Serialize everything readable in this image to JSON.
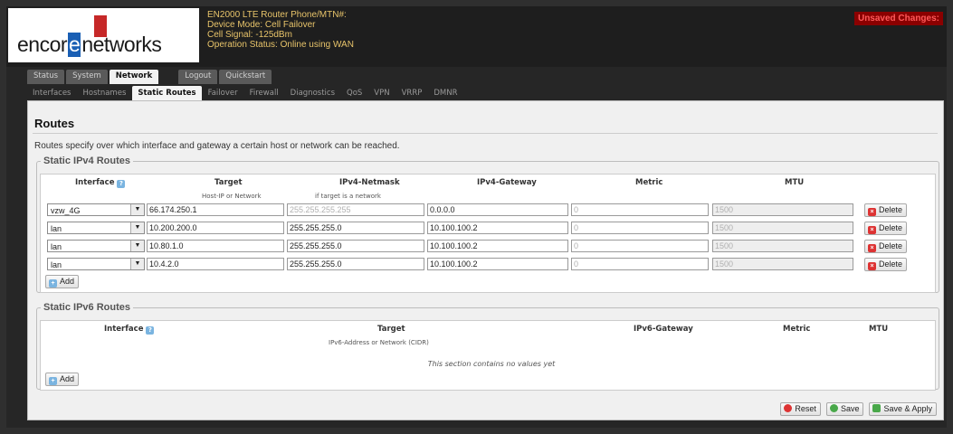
{
  "header": {
    "logo": {
      "left": "encor",
      "mid": "e",
      "right": "networks"
    },
    "status_lines": [
      "EN2000 LTE Router Phone/MTN#:",
      "Device Mode: Cell Failover",
      "Cell Signal: -125dBm",
      "Operation Status: Online using WAN"
    ],
    "unsaved": "Unsaved Changes:"
  },
  "nav": {
    "tabs": [
      "Status",
      "System",
      "Network",
      "Logout",
      "Quickstart"
    ],
    "active_tab": "Network",
    "subtabs": [
      "Interfaces",
      "Hostnames",
      "Static Routes",
      "Failover",
      "Firewall",
      "Diagnostics",
      "QoS",
      "VPN",
      "VRRP",
      "DMNR"
    ],
    "active_subtab": "Static Routes"
  },
  "page": {
    "title": "Routes",
    "description": "Routes specify over which interface and gateway a certain host or network can be reached."
  },
  "ipv4": {
    "legend": "Static IPv4 Routes",
    "headers": {
      "interface": "Interface",
      "target": "Target",
      "netmask": "IPv4-Netmask",
      "gateway": "IPv4-Gateway",
      "metric": "Metric",
      "mtu": "MTU"
    },
    "hints": {
      "target": "Host-IP or Network",
      "netmask": "if target is a network"
    },
    "rows": [
      {
        "interface": "vzw_4G",
        "target": "66.174.250.1",
        "netmask": "255.255.255.255",
        "netmask_placeholder": true,
        "gateway": "0.0.0.0",
        "metric": "0",
        "mtu": "1500",
        "delete": "Delete"
      },
      {
        "interface": "lan",
        "target": "10.200.200.0",
        "netmask": "255.255.255.0",
        "netmask_placeholder": false,
        "gateway": "10.100.100.2",
        "metric": "0",
        "mtu": "1500",
        "delete": "Delete"
      },
      {
        "interface": "lan",
        "target": "10.80.1.0",
        "netmask": "255.255.255.0",
        "netmask_placeholder": false,
        "gateway": "10.100.100.2",
        "metric": "0",
        "mtu": "1500",
        "delete": "Delete"
      },
      {
        "interface": "lan",
        "target": "10.4.2.0",
        "netmask": "255.255.255.0",
        "netmask_placeholder": false,
        "gateway": "10.100.100.2",
        "metric": "0",
        "mtu": "1500",
        "delete": "Delete"
      }
    ],
    "add_label": "Add"
  },
  "ipv6": {
    "legend": "Static IPv6 Routes",
    "headers": {
      "interface": "Interface",
      "target": "Target",
      "gateway": "IPv6-Gateway",
      "metric": "Metric",
      "mtu": "MTU"
    },
    "hints": {
      "target": "IPv6-Address or Network (CIDR)"
    },
    "empty": "This section contains no values yet",
    "add_label": "Add"
  },
  "footer": {
    "reset": "Reset",
    "save": "Save",
    "save_apply": "Save & Apply"
  }
}
